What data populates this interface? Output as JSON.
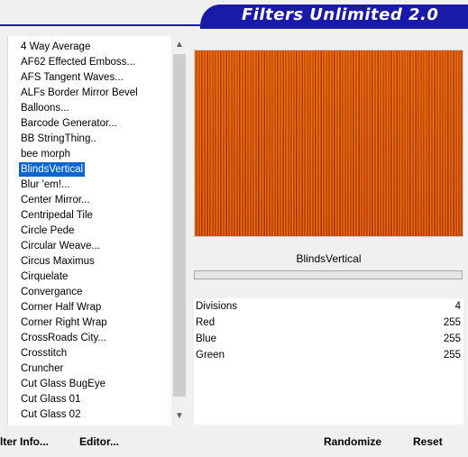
{
  "banner": {
    "title": "Filters Unlimited 2.0"
  },
  "filter_list": {
    "items": [
      "4 Way Average",
      "AF62 Effected Emboss...",
      "AFS Tangent Waves...",
      "ALFs Border Mirror Bevel",
      "Balloons...",
      "Barcode Generator...",
      "BB StringThing..",
      "bee morph",
      "BlindsVertical",
      "Blur 'em!...",
      "Center Mirror...",
      "Centripedal Tile",
      "Circle Pede",
      "Circular Weave...",
      "Circus Maximus",
      "Cirquelate",
      "Convergance",
      "Corner Half Wrap",
      "Corner Right Wrap",
      "CrossRoads City...",
      "Crosstitch",
      "Cruncher",
      "Cut Glass  BugEye",
      "Cut Glass 01",
      "Cut Glass 02"
    ],
    "selected_index": 8
  },
  "buttons": {
    "filter_info": "lter Info...",
    "editor": "Editor...",
    "randomize": "Randomize",
    "reset": "Reset"
  },
  "preview": {
    "filter_name": "BlindsVertical"
  },
  "parameters": [
    {
      "name": "Divisions",
      "value": "4"
    },
    {
      "name": "Red",
      "value": "255"
    },
    {
      "name": "Blue",
      "value": "255"
    },
    {
      "name": "Green",
      "value": "255"
    }
  ],
  "colors": {
    "banner": "#1a1aa8",
    "selection": "#0a64d2",
    "preview_orange": "#cc4a04"
  }
}
